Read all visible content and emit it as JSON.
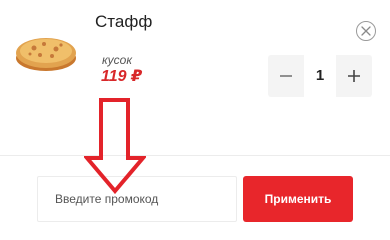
{
  "cart_item": {
    "name": "Стафф",
    "unit": "кусок",
    "price": "119 ₽",
    "quantity": "1",
    "image_icon": "pizza-icon",
    "remove_icon": "close-icon"
  },
  "stepper": {
    "minus_icon": "minus-icon",
    "plus_icon": "plus-icon"
  },
  "promo": {
    "placeholder": "Введите промокод",
    "apply_label": "Применить"
  },
  "colors": {
    "accent": "#e8262b",
    "price": "#d8282a",
    "stepper_bg": "#f4f4f4"
  }
}
